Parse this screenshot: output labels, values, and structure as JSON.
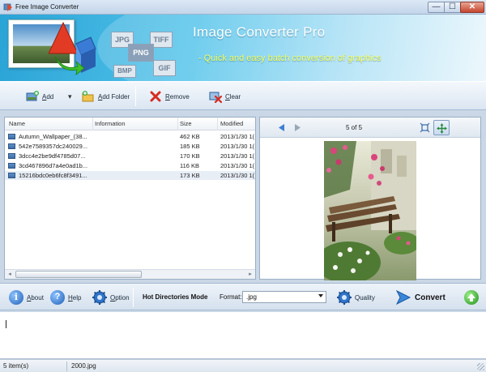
{
  "window": {
    "title": "Free Image Converter",
    "controls": {
      "minimize": "—",
      "maximize": "☐",
      "close": "✕"
    }
  },
  "banner": {
    "title": "Image Converter Pro",
    "subtitle": "- Quick and easy batch conversion of graphics",
    "format_icons": [
      "JPG",
      "TIFF",
      "PNG",
      "BMP",
      "GIF"
    ]
  },
  "toolbar": {
    "add": {
      "label_prefix": "",
      "label_key": "A",
      "label_rest": "dd"
    },
    "add_folder": {
      "label_key": "A",
      "label_rest": "dd Folder"
    },
    "remove": {
      "label_key": "R",
      "label_rest": "emove"
    },
    "clear": {
      "label_key": "C",
      "label_rest": "lear"
    },
    "dropdown_arrow": "▾"
  },
  "file_list": {
    "columns": [
      "Name",
      "Information",
      "Size",
      "Modified"
    ],
    "rows": [
      {
        "name": "Autumn_Wallpaper_(38...",
        "information": "",
        "size": "462 KB",
        "modified": "2013/1/30 1("
      },
      {
        "name": "542e7589357dc240029...",
        "information": "",
        "size": "185 KB",
        "modified": "2013/1/30 1("
      },
      {
        "name": "3dcc4e2be9df4785d07...",
        "information": "",
        "size": "170 KB",
        "modified": "2013/1/30 1("
      },
      {
        "name": "3cd467896d7a4e0ad1b...",
        "information": "",
        "size": "116 KB",
        "modified": "2013/1/30 1("
      },
      {
        "name": "15216bdc0eb6fc8f3491...",
        "information": "",
        "size": "173 KB",
        "modified": "2013/1/30 1("
      }
    ],
    "scroll_left": "◂",
    "scroll_right": "▸"
  },
  "preview": {
    "counter": "5 of 5"
  },
  "actions": {
    "about": {
      "key": "A",
      "rest": "bout"
    },
    "help": {
      "key": "H",
      "rest": "elp"
    },
    "option": {
      "key": "O",
      "rest": "ption"
    },
    "mode": "Hot Directories Mode",
    "mode_key_index_text": "M",
    "format_label": "Format:",
    "format_value": ".jpg",
    "quality": "Quality",
    "convert": "Convert"
  },
  "status": {
    "items": "5 item(s)",
    "current_file": "2000.jpg"
  },
  "colors": {
    "accent": "#2aa3d6",
    "subtitle": "#f7ff5a",
    "close_button": "#c6452d"
  }
}
